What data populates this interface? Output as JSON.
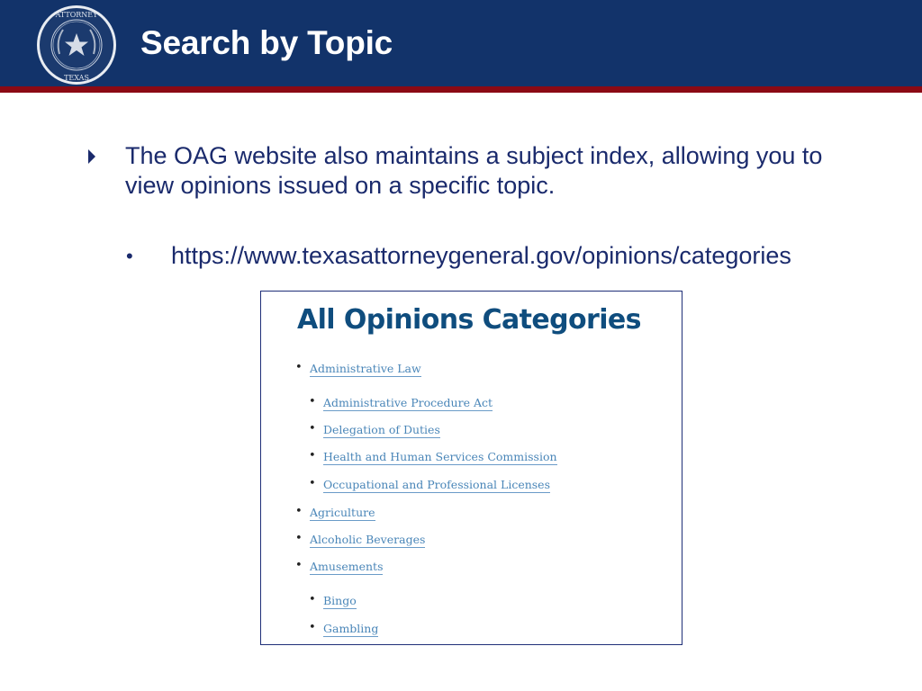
{
  "header": {
    "title": "Search by Topic",
    "seal": {
      "icon": "attorney-general-seal-icon",
      "ring_text_top": "THE ATTORNEY GENERAL",
      "ring_text_bottom": "TEXAS"
    },
    "colors": {
      "banner": "#12336a",
      "rule": "#8b0a14"
    }
  },
  "body": {
    "bullet_icon": "triangle-right-icon",
    "paragraph": "The OAG website also maintains a subject index, allowing you to view opinions issued on a specific topic.",
    "sub_bullet": "•",
    "url": "https://www.texasattorneygeneral.gov/opinions/categories",
    "text_color": "#1a2a6c"
  },
  "screenshot": {
    "title": "All Opinions Categories",
    "categories": [
      {
        "label": "Administrative Law",
        "level": 1
      },
      {
        "label": "Administrative Procedure Act",
        "level": 2
      },
      {
        "label": "Delegation of Duties",
        "level": 2
      },
      {
        "label": "Health and Human Services Commission",
        "level": 2
      },
      {
        "label": "Occupational and Professional Licenses",
        "level": 2
      },
      {
        "label": "Agriculture",
        "level": 1
      },
      {
        "label": "Alcoholic Beverages",
        "level": 1
      },
      {
        "label": "Amusements",
        "level": 1
      },
      {
        "label": "Bingo",
        "level": 2
      },
      {
        "label": "Gambling",
        "level": 2
      }
    ],
    "bullet": "•"
  }
}
